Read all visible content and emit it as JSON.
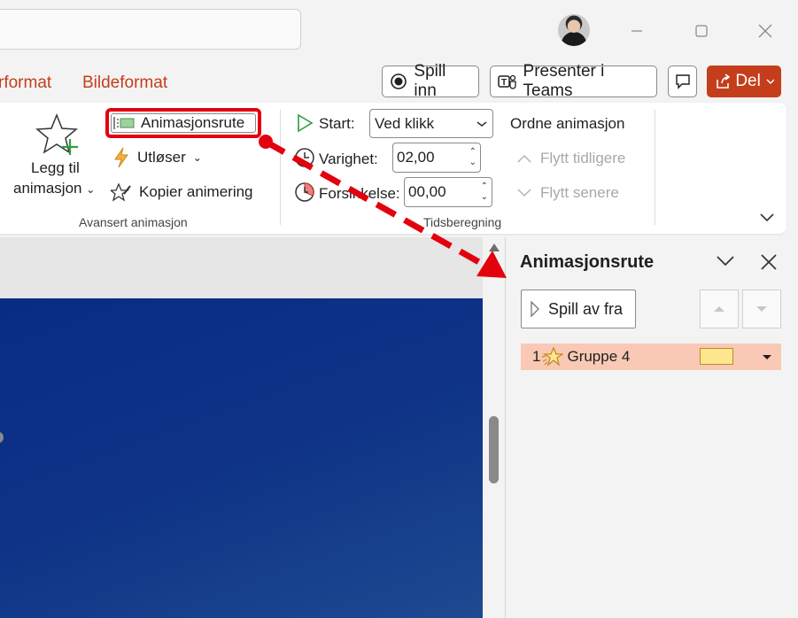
{
  "tabs": {
    "format_partial": "rformat",
    "picture_format": "Bildeformat"
  },
  "header_buttons": {
    "record": "Spill inn",
    "present_teams": "Presenter i Teams",
    "share": "Del"
  },
  "ribbon": {
    "add_animation_line1": "Legg til",
    "add_animation_line2": "animasjon",
    "animation_pane": "Animasjonsrute",
    "trigger": "Utløser",
    "copy_animation": "Kopier animering",
    "advanced_group": "Avansert animasjon",
    "start_label": "Start:",
    "start_value": "Ved klikk",
    "duration_label": "Varighet:",
    "duration_value": "02,00",
    "delay_label": "Forsinkelse:",
    "delay_value": "00,00",
    "timing_group": "Tidsberegning",
    "reorder_title": "Ordne animasjon",
    "move_earlier": "Flytt tidligere",
    "move_later": "Flytt senere"
  },
  "pane": {
    "title": "Animasjonsrute",
    "play_from": "Spill av fra",
    "items": [
      {
        "number": "1",
        "name": "Gruppe 4"
      }
    ]
  },
  "colors": {
    "accent": "#c43e1c",
    "highlight_annotation": "#e3000f",
    "selected_row": "#f9c9b5",
    "slide_bg": "#0e3387"
  }
}
